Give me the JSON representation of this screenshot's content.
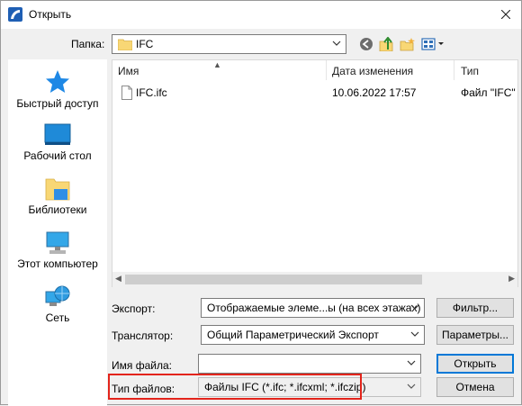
{
  "window": {
    "title": "Открыть"
  },
  "folder": {
    "label": "Папка:",
    "value": "IFC"
  },
  "places": [
    {
      "label": "Быстрый доступ",
      "icon": "star-icon"
    },
    {
      "label": "Рабочий стол",
      "icon": "desktop-icon"
    },
    {
      "label": "Библиотеки",
      "icon": "libraries-icon"
    },
    {
      "label": "Этот компьютер",
      "icon": "computer-icon"
    },
    {
      "label": "Сеть",
      "icon": "network-icon"
    }
  ],
  "file_list": {
    "columns": [
      "Имя",
      "Дата изменения",
      "Тип"
    ],
    "rows": [
      {
        "name": "IFC.ifc",
        "date": "10.06.2022 17:57",
        "type": "Файл \"IFC\""
      }
    ]
  },
  "form": {
    "export_label": "Экспорт:",
    "export_value": "Отображаемые элеме...ы (на всех этажах)",
    "filter_button": "Фильтр...",
    "translator_label": "Транслятор:",
    "translator_value": "Общий Параметрический Экспорт",
    "params_button": "Параметры...",
    "filename_label": "Имя файла:",
    "filename_value": "",
    "open_button": "Открыть",
    "filetype_label": "Тип файлов:",
    "filetype_value": "Файлы IFC (*.ifc; *.ifcxml; *.ifczip)",
    "cancel_button": "Отмена"
  },
  "colors": {
    "accent": "#0078d7",
    "highlight": "#e3241b",
    "folder": "#f8d775"
  }
}
